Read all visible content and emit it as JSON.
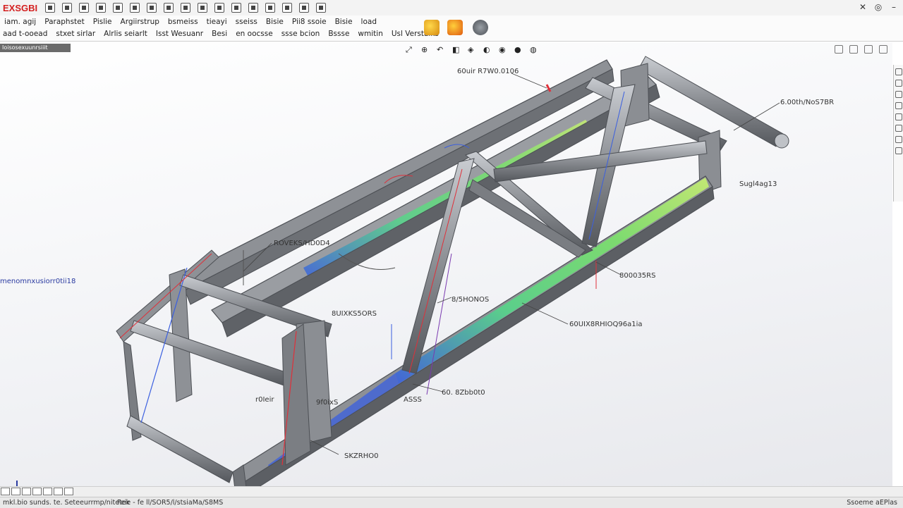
{
  "app": {
    "logo_text": "EXSGBI"
  },
  "ribbon": {
    "row1": [
      "iam. agij",
      "Paraphstet",
      "Pislie",
      "Argiirstrup",
      "bsmeiss",
      "tieayi",
      "sseiss",
      "Bisie",
      "Pii8 ssoie",
      "Bisie",
      "load"
    ],
    "row2": [
      "aad t-ooead",
      "stxet sirlar",
      "Alrlis seiarlt",
      "Isst Wesuanr",
      "Besi",
      "en oocsse",
      "ssse bcion",
      "Bssse",
      "wmitin",
      "Usl Verstaiks"
    ]
  },
  "feature_panel": {
    "label": "Ioisosexuunrsiiit"
  },
  "left_note": "menomnxusiorr0tii18",
  "callouts": [
    {
      "id": "c1",
      "text": "60uir R7W0.0106"
    },
    {
      "id": "c2",
      "text": "6.00th/NoS7BR"
    },
    {
      "id": "c3",
      "text": "Sugl4ag13"
    },
    {
      "id": "c4",
      "text": "ROVEKS/HD0D4"
    },
    {
      "id": "c5",
      "text": "800035RS"
    },
    {
      "id": "c6",
      "text": "8/5HONOS"
    },
    {
      "id": "c7",
      "text": "8UIXKS5ORS"
    },
    {
      "id": "c8",
      "text": "60UIX8RHIOQ96a1ia"
    },
    {
      "id": "c9",
      "text": "60. 8Zbb0t0"
    },
    {
      "id": "c10",
      "text": "ASSS"
    },
    {
      "id": "c11",
      "text": "9f0ixS"
    },
    {
      "id": "c12",
      "text": "r0Ieir"
    },
    {
      "id": "c13",
      "text": "SKZRHO0"
    }
  ],
  "status": {
    "left": "mkl.bio sunds. te. Seteeurrmp/nitetek",
    "middle": "Feie - fe ll/SOR5/l/stsiaMa/S8MS",
    "right": "Ssoeme aEPlas"
  },
  "colors": {
    "frame": "#8a8d92",
    "frame_dark": "#55585d",
    "fea_green": "#7be36b",
    "fea_blue": "#3a5fe0",
    "fea_red": "#e0303a",
    "logo_red": "#d42020"
  }
}
